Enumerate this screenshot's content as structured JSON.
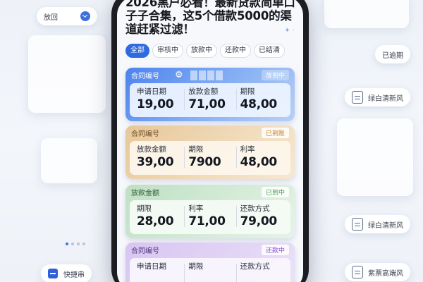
{
  "background": {
    "select": {
      "label": "放回"
    },
    "left_bottom_button": {
      "label": "快捷串"
    },
    "right_items": [
      {
        "label": "已逾期"
      },
      {
        "label": "绿白清新风"
      },
      {
        "label": "绿白清新风"
      },
      {
        "label": "紫票高端风"
      }
    ]
  },
  "article": {
    "title": "2026黑户必看！最新贷款简单口子子合集，这5个借款5000的渠道赶紧过滤！"
  },
  "tabs": [
    "全部",
    "审核中",
    "放款中",
    "还款中",
    "已结清"
  ],
  "cards": [
    {
      "header": "合同编号",
      "status": "放到中",
      "fields": [
        {
          "label": "申请日期",
          "value": "19,00"
        },
        {
          "label": "放款金额",
          "value": "71,00"
        },
        {
          "label": "期限",
          "value": "48,00"
        }
      ]
    },
    {
      "header": "合同编号",
      "status": "已到账",
      "fields": [
        {
          "label": "放款金额",
          "value": "39,00"
        },
        {
          "label": "期限",
          "value": "7900"
        },
        {
          "label": "利率",
          "value": "48,00"
        }
      ]
    },
    {
      "header": "放款金额",
      "status": "已到中",
      "fields": [
        {
          "label": "期限",
          "value": "28,00"
        },
        {
          "label": "利率",
          "value": "71,00"
        },
        {
          "label": "还款方式",
          "value": "79,00"
        }
      ]
    },
    {
      "header": "合同编号",
      "status": "还款中",
      "fields": [
        {
          "label": "申请日期",
          "value": ""
        },
        {
          "label": "期限",
          "value": ""
        },
        {
          "label": "还款方式",
          "value": ""
        }
      ]
    }
  ],
  "colors": {
    "accent": "#2f6ae0",
    "card_blue": "#4b83ee",
    "card_gold": "#e7c799",
    "card_green": "#bfe0c4",
    "card_purple": "#d8c5f1"
  }
}
